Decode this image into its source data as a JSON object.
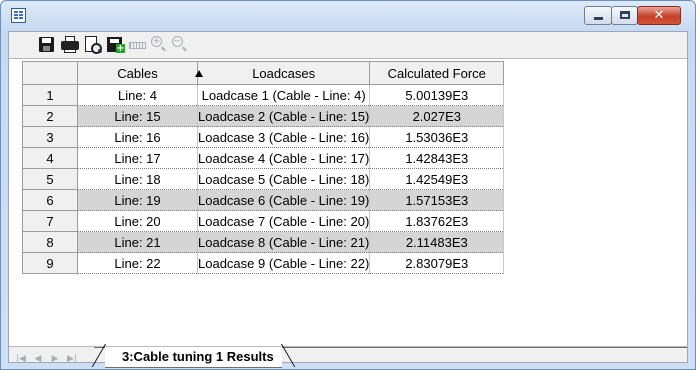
{
  "window": {
    "title": "",
    "close_glyph": "✕"
  },
  "toolbar": {
    "items": [
      "save-icon",
      "print-icon",
      "print-preview-icon",
      "export-icon",
      "ruler-icon",
      "zoom-in-icon",
      "zoom-out-icon"
    ],
    "zoom_in_glyph": "+",
    "zoom_out_glyph": "−"
  },
  "table": {
    "headers": [
      "Cables",
      "Loadcases",
      "Calculated Force"
    ],
    "sorted_column": "Cables",
    "sort_direction": "ascending",
    "rows": [
      {
        "num": "1",
        "cable": "Line: 4",
        "loadcase": "Loadcase 1 (Cable - Line: 4)",
        "force": "5.00139E3"
      },
      {
        "num": "2",
        "cable": "Line: 15",
        "loadcase": "Loadcase 2 (Cable - Line: 15)",
        "force": "2.027E3"
      },
      {
        "num": "3",
        "cable": "Line: 16",
        "loadcase": "Loadcase 3 (Cable - Line: 16)",
        "force": "1.53036E3"
      },
      {
        "num": "4",
        "cable": "Line: 17",
        "loadcase": "Loadcase 4 (Cable - Line: 17)",
        "force": "1.42843E3"
      },
      {
        "num": "5",
        "cable": "Line: 18",
        "loadcase": "Loadcase 5 (Cable - Line: 18)",
        "force": "1.42549E3"
      },
      {
        "num": "6",
        "cable": "Line: 19",
        "loadcase": "Loadcase 6 (Cable - Line: 19)",
        "force": "1.57153E3"
      },
      {
        "num": "7",
        "cable": "Line: 20",
        "loadcase": "Loadcase 7 (Cable - Line: 20)",
        "force": "1.83762E3"
      },
      {
        "num": "8",
        "cable": "Line: 21",
        "loadcase": "Loadcase 8 (Cable - Line: 21)",
        "force": "2.11483E3"
      },
      {
        "num": "9",
        "cable": "Line: 22",
        "loadcase": "Loadcase 9 (Cable - Line: 22)",
        "force": "2.83079E3"
      }
    ]
  },
  "tabs": {
    "nav": [
      "|◀",
      "◀",
      "▶",
      "▶|"
    ],
    "active": "3:Cable tuning 1 Results"
  },
  "colors": {
    "titlebar": "#c7daf1",
    "close_button": "#c4402a",
    "shaded_row": "#d5d5d5"
  }
}
